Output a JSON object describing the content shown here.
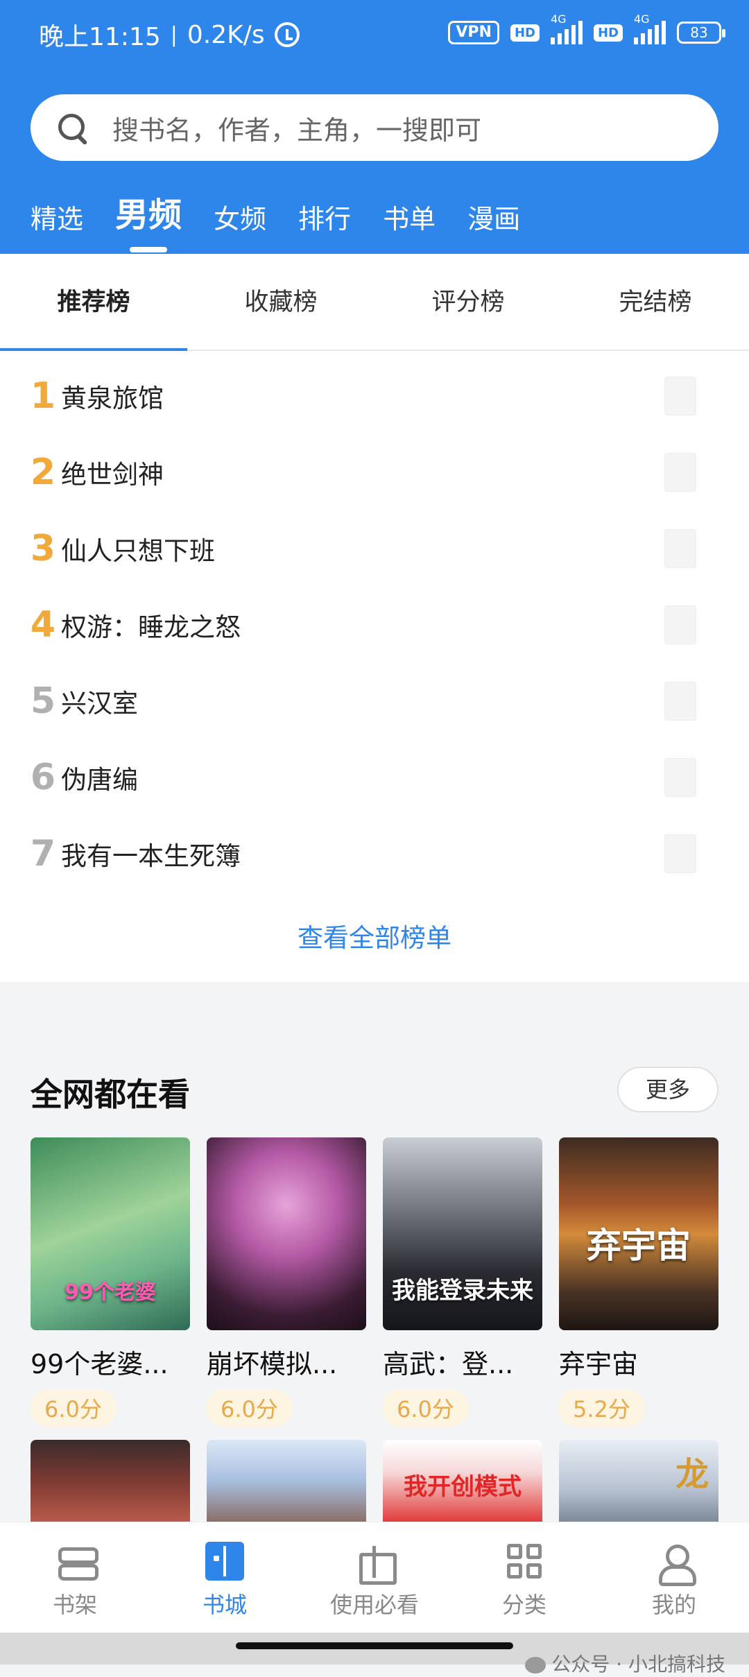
{
  "status_bar": {
    "time": "晚上11:15",
    "speed": "0.2K/s",
    "vpn": "VPN",
    "hd": "HD",
    "network": "4G",
    "battery": "83"
  },
  "search": {
    "placeholder": "搜书名，作者，主角，一搜即可"
  },
  "top_tabs": [
    "精选",
    "男频",
    "女频",
    "排行",
    "书单",
    "漫画"
  ],
  "rank_tabs": [
    "推荐榜",
    "收藏榜",
    "评分榜",
    "完结榜"
  ],
  "rank_list": [
    {
      "rank": "1",
      "title": "黄泉旅馆"
    },
    {
      "rank": "2",
      "title": "绝世剑神"
    },
    {
      "rank": "3",
      "title": "仙人只想下班"
    },
    {
      "rank": "4",
      "title": "权游：睡龙之怒"
    },
    {
      "rank": "5",
      "title": "兴汉室"
    },
    {
      "rank": "6",
      "title": "伪唐编"
    },
    {
      "rank": "7",
      "title": "我有一本生死簿"
    }
  ],
  "view_all": "查看全部榜单",
  "section": {
    "title": "全网都在看",
    "more": "更多"
  },
  "books": [
    {
      "title": "99个老婆...",
      "score": "6.0分",
      "cover_text": "99个老婆"
    },
    {
      "title": "崩坏模拟...",
      "score": "6.0分",
      "cover_text": ""
    },
    {
      "title": "高武：登...",
      "score": "6.0分",
      "cover_text": "我能登录未来"
    },
    {
      "title": "弃宇宙",
      "score": "5.2分",
      "cover_text": "弃宇宙"
    }
  ],
  "row2_covers": [
    "",
    "",
    "我开创模式",
    "龙"
  ],
  "bottom_nav": [
    {
      "label": "书架",
      "icon": "bookshelf-icon"
    },
    {
      "label": "书城",
      "icon": "book-open-icon"
    },
    {
      "label": "使用必看",
      "icon": "gift-icon"
    },
    {
      "label": "分类",
      "icon": "grid-icon"
    },
    {
      "label": "我的",
      "icon": "user-icon"
    }
  ],
  "watermark": "公众号 · 小北搞科技",
  "colors": {
    "primary": "#2f86ea",
    "rank_top": "#f0a93a",
    "score_bg": "#fdf4e1"
  }
}
